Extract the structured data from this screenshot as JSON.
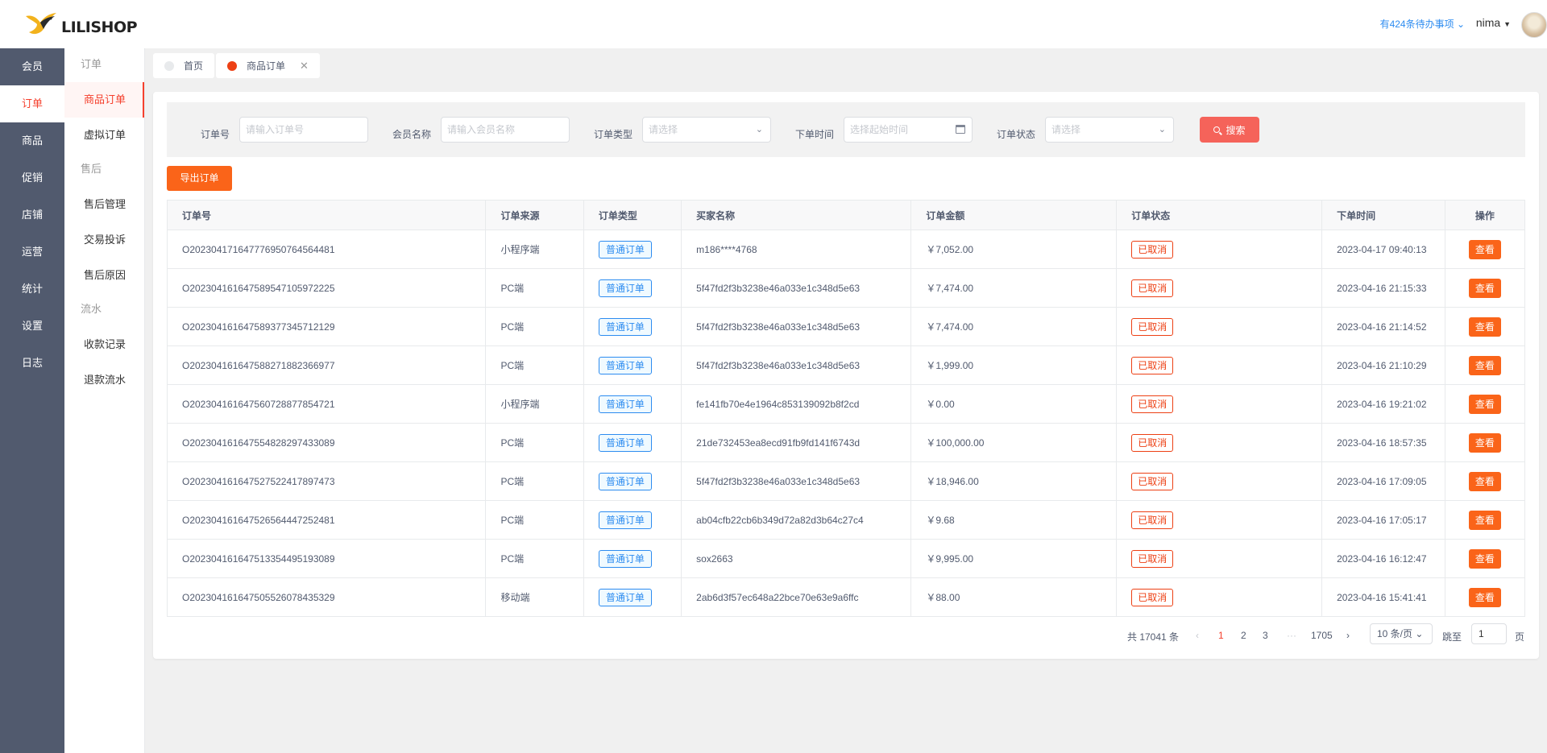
{
  "brand": {
    "name": "LILISHOP"
  },
  "header": {
    "todo_text": "有424条待办事项",
    "username": "nima"
  },
  "main_menu": [
    "会员",
    "订单",
    "商品",
    "促销",
    "店铺",
    "运营",
    "统计",
    "设置",
    "日志"
  ],
  "sub_menu": {
    "group_order": "订单",
    "item_goods_order": "商品订单",
    "item_virtual_order": "虚拟订单",
    "group_aftersale": "售后",
    "item_aftersale_manage": "售后管理",
    "item_complaint": "交易投诉",
    "item_aftersale_reason": "售后原因",
    "group_flow": "流水",
    "item_receipt": "收款记录",
    "item_refund_flow": "退款流水"
  },
  "tabs": [
    {
      "label": "首页",
      "color": "#e8eaec"
    },
    {
      "label": "商品订单",
      "color": "#ed4014"
    }
  ],
  "search": {
    "order_no_label": "订单号",
    "order_no_placeholder": "请输入订单号",
    "member_label": "会员名称",
    "member_placeholder": "请输入会员名称",
    "type_label": "订单类型",
    "type_placeholder": "请选择",
    "time_label": "下单时间",
    "time_placeholder": "选择起始时间",
    "status_label": "订单状态",
    "status_placeholder": "请选择",
    "button": "搜索"
  },
  "export_button": "导出订单",
  "table": {
    "columns": [
      "订单号",
      "订单来源",
      "订单类型",
      "买家名称",
      "订单金额",
      "订单状态",
      "下单时间",
      "操作"
    ],
    "rows": [
      [
        "O202304171647776950764564481",
        "小程序端",
        "普通订单",
        "m186****4768",
        "￥7,052.00",
        "已取消",
        "2023-04-17 09:40:13",
        "查看"
      ],
      [
        "O202304161647589547105972225",
        "PC端",
        "普通订单",
        "5f47fd2f3b3238e46a033e1c348d5e63",
        "￥7,474.00",
        "已取消",
        "2023-04-16 21:15:33",
        "查看"
      ],
      [
        "O202304161647589377345712129",
        "PC端",
        "普通订单",
        "5f47fd2f3b3238e46a033e1c348d5e63",
        "￥7,474.00",
        "已取消",
        "2023-04-16 21:14:52",
        "查看"
      ],
      [
        "O202304161647588271882366977",
        "PC端",
        "普通订单",
        "5f47fd2f3b3238e46a033e1c348d5e63",
        "￥1,999.00",
        "已取消",
        "2023-04-16 21:10:29",
        "查看"
      ],
      [
        "O202304161647560728877854721",
        "小程序端",
        "普通订单",
        "fe141fb70e4e1964c853139092b8f2cd",
        "￥0.00",
        "已取消",
        "2023-04-16 19:21:02",
        "查看"
      ],
      [
        "O202304161647554828297433089",
        "PC端",
        "普通订单",
        "21de732453ea8ecd91fb9fd141f6743d",
        "￥100,000.00",
        "已取消",
        "2023-04-16 18:57:35",
        "查看"
      ],
      [
        "O202304161647527522417897473",
        "PC端",
        "普通订单",
        "5f47fd2f3b3238e46a033e1c348d5e63",
        "￥18,946.00",
        "已取消",
        "2023-04-16 17:09:05",
        "查看"
      ],
      [
        "O202304161647526564447252481",
        "PC端",
        "普通订单",
        "ab04cfb22cb6b349d72a82d3b64c27c4",
        "￥9.68",
        "已取消",
        "2023-04-16 17:05:17",
        "查看"
      ],
      [
        "O202304161647513354495193089",
        "PC端",
        "普通订单",
        "sox2663",
        "￥9,995.00",
        "已取消",
        "2023-04-16 16:12:47",
        "查看"
      ],
      [
        "O202304161647505526078435329",
        "移动端",
        "普通订单",
        "2ab6d3f57ec648a22bce70e63e9a6ffc",
        "￥88.00",
        "已取消",
        "2023-04-16 15:41:41",
        "查看"
      ]
    ]
  },
  "pagination": {
    "total": "共 17041 条",
    "prev": "‹",
    "pages": [
      "1",
      "2",
      "3"
    ],
    "ellipsis": "···",
    "last_page": "1705",
    "next": "›",
    "page_size": "10 条/页",
    "jump_label": "跳至",
    "jump_value": "1",
    "page_suffix": "页"
  },
  "colors": {
    "accent": "#f5402d",
    "sidebar": "#515a6e",
    "orange": "#fa6419",
    "blue": "#2d8cf0"
  }
}
